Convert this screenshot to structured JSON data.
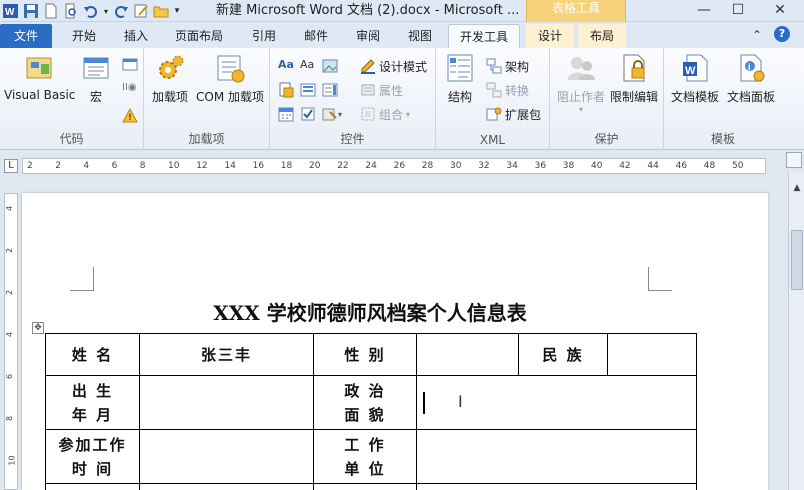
{
  "window": {
    "title": "新建 Microsoft Word 文档 (2).docx - Microsoft ...",
    "context_tab_group": "表格工具"
  },
  "tabs": [
    {
      "label": "文件"
    },
    {
      "label": "开始"
    },
    {
      "label": "插入"
    },
    {
      "label": "页面布局"
    },
    {
      "label": "引用"
    },
    {
      "label": "邮件"
    },
    {
      "label": "审阅"
    },
    {
      "label": "视图"
    },
    {
      "label": "开发工具"
    },
    {
      "label": "设计"
    },
    {
      "label": "布局"
    }
  ],
  "ribbon": {
    "groups": {
      "code": "代码",
      "addins": "加载项",
      "controls": "控件",
      "xml": "XML",
      "protect": "保护",
      "templates": "模板"
    },
    "buttons": {
      "visual_basic": "Visual Basic",
      "macro": "宏",
      "addins": "加载项",
      "com_addins": "COM 加载项",
      "design_mode": "设计模式",
      "properties": "属性",
      "group": "组合",
      "structure": "结构",
      "schema": "架构",
      "transform": "转换",
      "expansion_pack": "扩展包",
      "block_authors": "阻止作者",
      "restrict_editing": "限制编辑",
      "document_template": "文档模板",
      "document_panel": "文档面板"
    }
  },
  "ruler": {
    "ticks": [
      "2",
      "2",
      "4",
      "6",
      "8",
      "10",
      "12",
      "14",
      "16",
      "18",
      "20",
      "22",
      "24",
      "26",
      "28",
      "30",
      "32",
      "34",
      "36",
      "38",
      "40",
      "42",
      "44",
      "46",
      "48",
      "50"
    ],
    "vticks": [
      "4",
      "2",
      "2",
      "4",
      "6",
      "8",
      "10"
    ]
  },
  "document": {
    "title": "XXX 学校师德师风档案个人信息表",
    "table": {
      "row1": {
        "name_label": "姓 名",
        "name_value": "张三丰",
        "gender_label": "性 别",
        "gender_value": "",
        "ethnicity_label": "民 族",
        "ethnicity_value": ""
      },
      "row2": {
        "birth_label_1": "出 生",
        "birth_label_2": "年 月",
        "birth_value": "",
        "political_label_1": "政 治",
        "political_label_2": "面 貌",
        "political_value": ""
      },
      "row3": {
        "work_start_label_1": "参加工作",
        "work_start_label_2": "时 间",
        "work_start_value": "",
        "work_unit_label_1": "工 作",
        "work_unit_label_2": "单 位",
        "work_unit_value": ""
      }
    }
  },
  "colors": {
    "file_tab": "#2b6cc4",
    "context_tab": "#f6d27a",
    "ribbon_bg": "#e8eef7"
  }
}
